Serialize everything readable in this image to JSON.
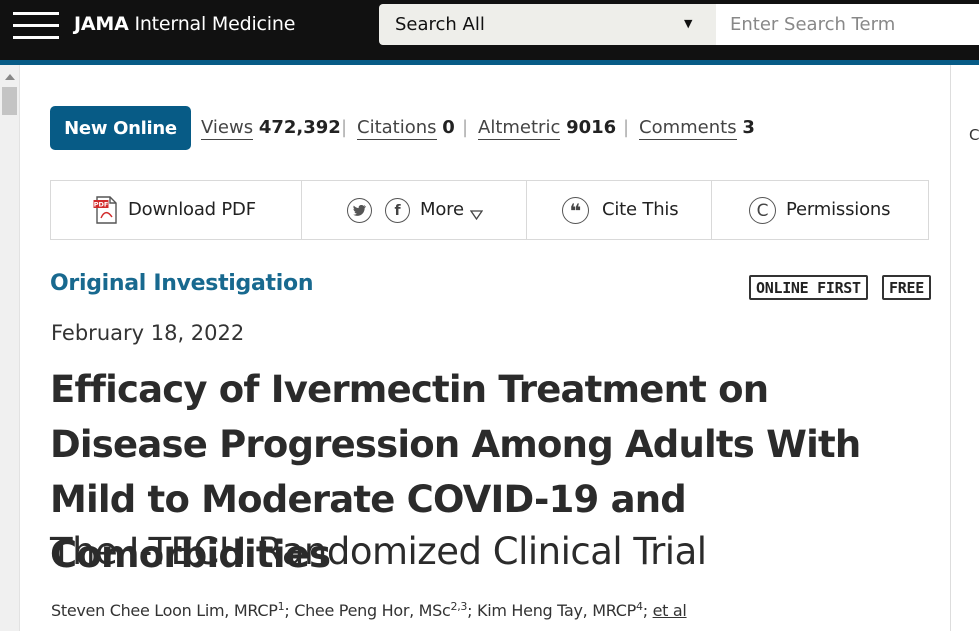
{
  "header": {
    "brand_bold": "JAMA",
    "brand_rest": "Internal Medicine",
    "search_scope": "Search All",
    "search_placeholder": "Enter Search Term"
  },
  "metrics": {
    "badge": "New Online",
    "views_label": "Views",
    "views_value": "472,392",
    "citations_label": "Citations",
    "citations_value": "0",
    "altmetric_label": "Altmetric",
    "altmetric_value": "9016",
    "comments_label": "Comments",
    "comments_value": "3",
    "separator": "|"
  },
  "toolbar": {
    "download": "Download PDF",
    "more": "More",
    "cite": "Cite This",
    "permissions": "Permissions"
  },
  "icons": {
    "pdf": "pdf-file-icon",
    "twitter": "twitter-icon",
    "facebook": "facebook-icon",
    "more_caret": "triangle-down-icon",
    "cite": "quote-icon",
    "permissions": "copyright-icon"
  },
  "article": {
    "type": "Original Investigation",
    "badges": [
      "ONLINE FIRST",
      "FREE"
    ],
    "date": "February 18, 2022",
    "title": "Efficacy of Ivermectin Treatment on Disease Progression Among Adults With Mild to Moderate COVID-19 and Comorbidities",
    "subtitle": "The I-TECH Randomized Clinical Trial",
    "authors": [
      {
        "name": "Steven Chee Loon Lim, MRCP",
        "sup": "1"
      },
      {
        "name": "Chee Peng Hor, MSc",
        "sup": "2,3"
      },
      {
        "name": "Kim Heng Tay, MRCP",
        "sup": "4"
      }
    ],
    "authors_more": "et al"
  },
  "right_edge_text": "C",
  "colors": {
    "header_bg": "#111111",
    "accent": "#075b86",
    "article_type": "#18698f",
    "pdf_red": "#d22b2b"
  }
}
